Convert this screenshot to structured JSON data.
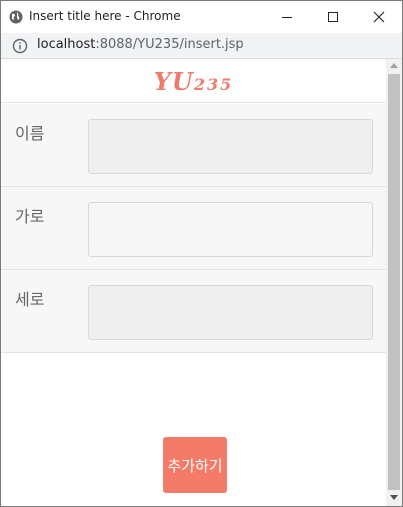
{
  "window": {
    "title": "Insert title here - Chrome",
    "icons": {
      "app": "globe-icon",
      "minimize": "minimize-icon",
      "maximize": "maximize-icon",
      "close": "close-icon"
    }
  },
  "address": {
    "info_icon": "info-icon",
    "host": "localhost",
    "path": ":8088/YU235/insert.jsp"
  },
  "brand": {
    "main": "YU",
    "num": "235"
  },
  "form": {
    "fields": [
      {
        "label": "이름",
        "value": ""
      },
      {
        "label": "가로",
        "value": ""
      },
      {
        "label": "세로",
        "value": ""
      }
    ],
    "submit_label": "추가하기"
  },
  "colors": {
    "accent": "#f47b67",
    "brand": "#f07b6a"
  }
}
